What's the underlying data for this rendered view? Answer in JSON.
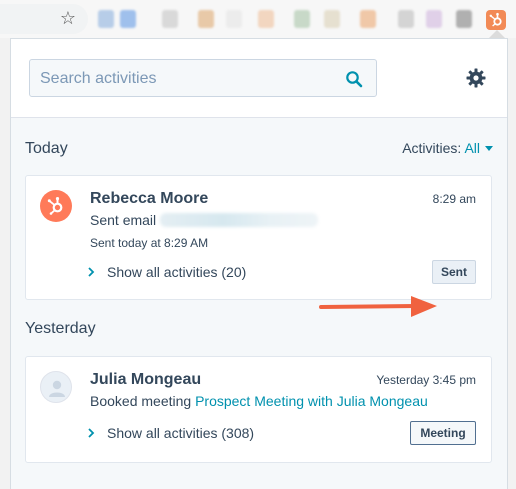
{
  "browser": {
    "star_icon": "star-icon",
    "extension_icon": "hubspot-sprocket-icon"
  },
  "search": {
    "placeholder": "Search activities"
  },
  "filter": {
    "label": "Activities:",
    "value": "All"
  },
  "sections": {
    "today": "Today",
    "yesterday": "Yesterday"
  },
  "activities": [
    {
      "contact_name": "Rebecca Moore",
      "time": "8:29 am",
      "action": "Sent email",
      "sent_note": "Sent today at 8:29 AM",
      "show_all": "Show all activities (20)",
      "badge": "Sent"
    },
    {
      "contact_name": "Julia Mongeau",
      "time": "Yesterday 3:45 pm",
      "action": "Booked meeting",
      "link": "Prospect Meeting with Julia Mongeau",
      "show_all": "Show all activities (308)",
      "badge": "Meeting"
    }
  ],
  "colors": {
    "accent_teal": "#0091ae",
    "hubspot_orange": "#ff7a59",
    "text_dark": "#33475b",
    "annotation_arrow": "#f0623f"
  }
}
